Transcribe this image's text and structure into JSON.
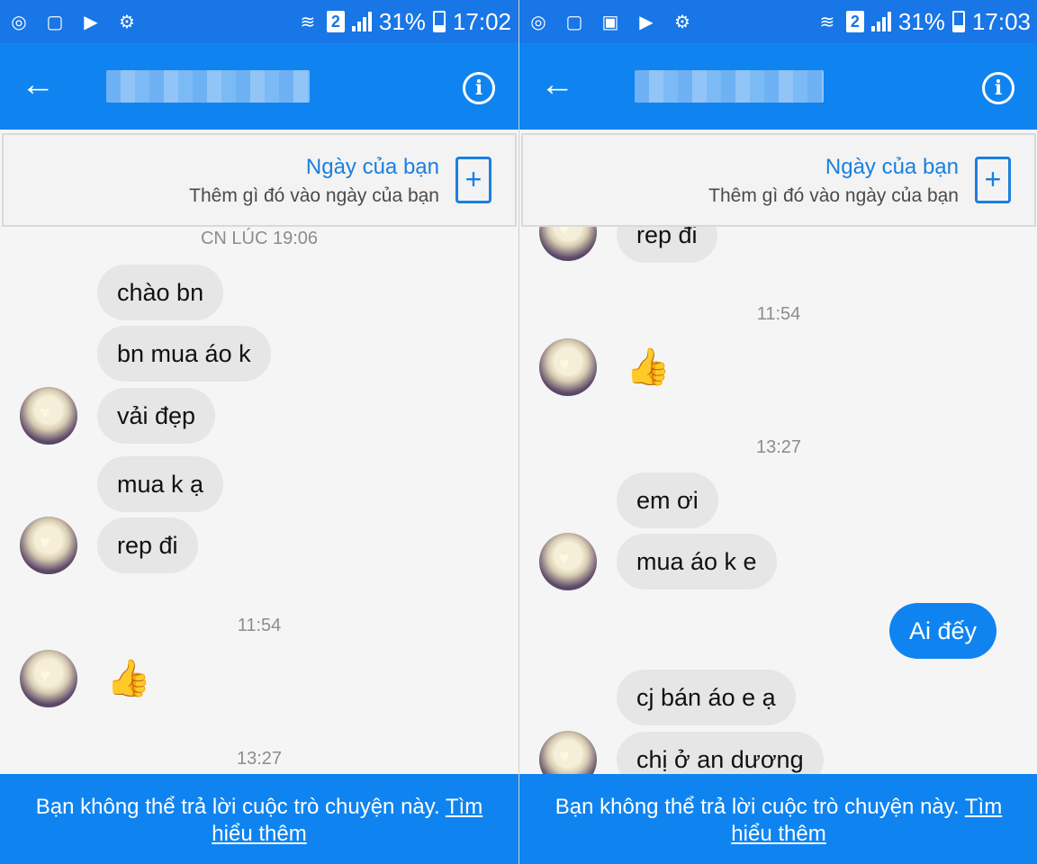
{
  "screens": [
    {
      "status": {
        "battery": "31%",
        "time": "17:02",
        "sim": "2"
      },
      "banner": {
        "title": "Ngày của bạn",
        "subtitle": "Thêm gì đó vào ngày của bạn",
        "add_icon": "+"
      },
      "timestamps": [
        "CN LÚC 19:06",
        "11:54",
        "13:27"
      ],
      "messages": [
        "chào bn",
        "bn mua áo k",
        "vải đẹp",
        "mua k ạ",
        "rep đi"
      ],
      "footer": {
        "text": "Bạn không thể trả lời cuộc trò chuyện này.",
        "link": "Tìm hiểu thêm"
      }
    },
    {
      "status": {
        "battery": "31%",
        "time": "17:03",
        "sim": "2"
      },
      "banner": {
        "title": "Ngày của bạn",
        "subtitle": "Thêm gì đó vào ngày của bạn",
        "add_icon": "+"
      },
      "timestamps": [
        "11:54",
        "13:27"
      ],
      "messages": [
        "rep đi",
        "em ơi",
        "mua áo k e",
        "Ai đếy",
        "cj bán áo e ạ",
        "chị ở an dương"
      ],
      "footer": {
        "text": "Bạn không thể trả lời cuộc trò chuyện này.",
        "link": "Tìm hiểu thêm"
      }
    }
  ],
  "colors": {
    "header": "#0f84f0",
    "statusbar": "#1876e6",
    "incoming_bubble": "#e6e6e6",
    "outgoing_bubble": "#0f84f0"
  },
  "icons": {
    "back": "arrow-left-icon",
    "info": "info-icon",
    "like": "thumbs-up-icon"
  }
}
